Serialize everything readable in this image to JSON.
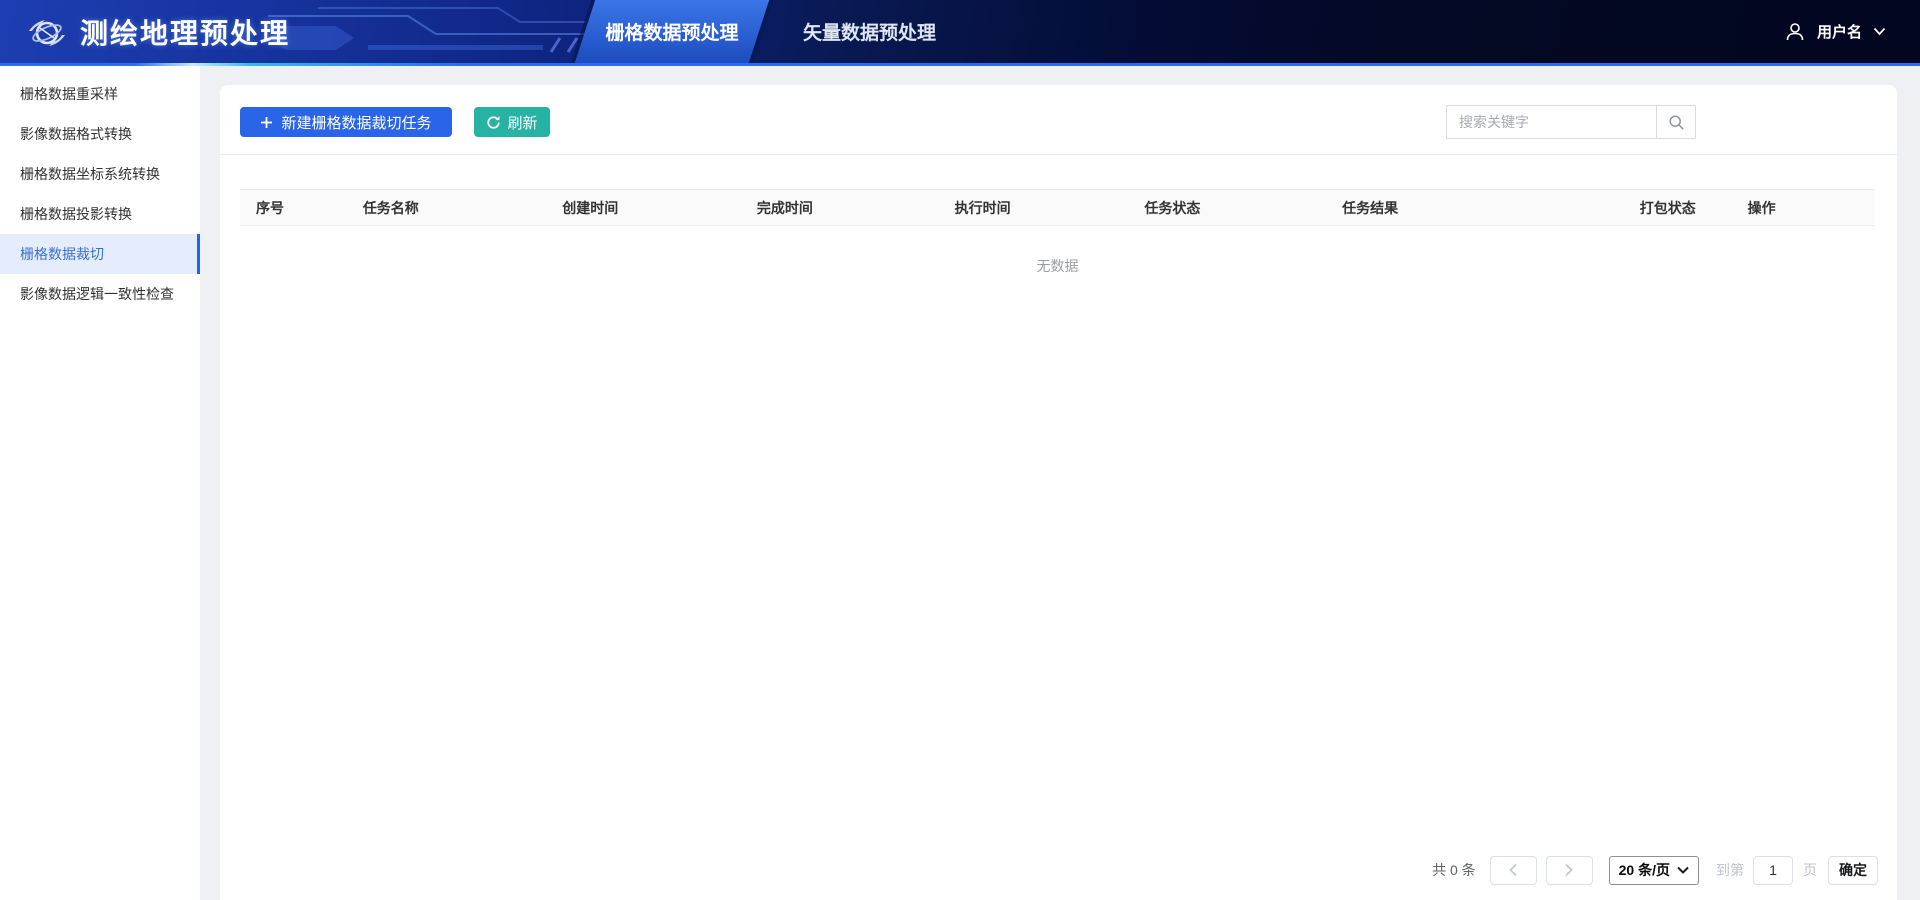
{
  "header": {
    "app_title": "测绘地理预处理",
    "tabs": [
      {
        "label": "栅格数据预处理",
        "active": true
      },
      {
        "label": "矢量数据预处理",
        "active": false
      }
    ],
    "user": {
      "name": "用户名"
    }
  },
  "sidebar": {
    "items": [
      {
        "label": "栅格数据重采样",
        "active": false
      },
      {
        "label": "影像数据格式转换",
        "active": false
      },
      {
        "label": "栅格数据坐标系统转换",
        "active": false
      },
      {
        "label": "栅格数据投影转换",
        "active": false
      },
      {
        "label": "栅格数据裁切",
        "active": true
      },
      {
        "label": "影像数据逻辑一致性检查",
        "active": false
      }
    ]
  },
  "toolbar": {
    "new_task_label": "新建栅格数据裁切任务",
    "refresh_label": "刷新",
    "search_placeholder": "搜索关键字"
  },
  "table": {
    "columns": [
      "序号",
      "任务名称",
      "创建时间",
      "完成时间",
      "执行时间",
      "任务状态",
      "任务结果",
      "打包状态",
      "操作"
    ],
    "rows": [],
    "empty_text": "无数据"
  },
  "pagination": {
    "total_text": "共 0 条",
    "page_size_label": "20 条/页",
    "goto_prefix": "到第",
    "page_value": "1",
    "goto_suffix": "页",
    "confirm_label": "确定"
  },
  "colors": {
    "primary_blue": "#2a64e8",
    "refresh_teal": "#27b3a4",
    "header_navy_left": "#16339e",
    "header_navy_right": "#030824",
    "header_accent_line": "#2a6df0",
    "active_menu_bg": "#e5edfc",
    "active_menu_text": "#3a6fd8",
    "active_menu_bar": "#1f64f0",
    "table_header_bg": "#fafafa",
    "empty_text_color": "#9a9da3"
  }
}
